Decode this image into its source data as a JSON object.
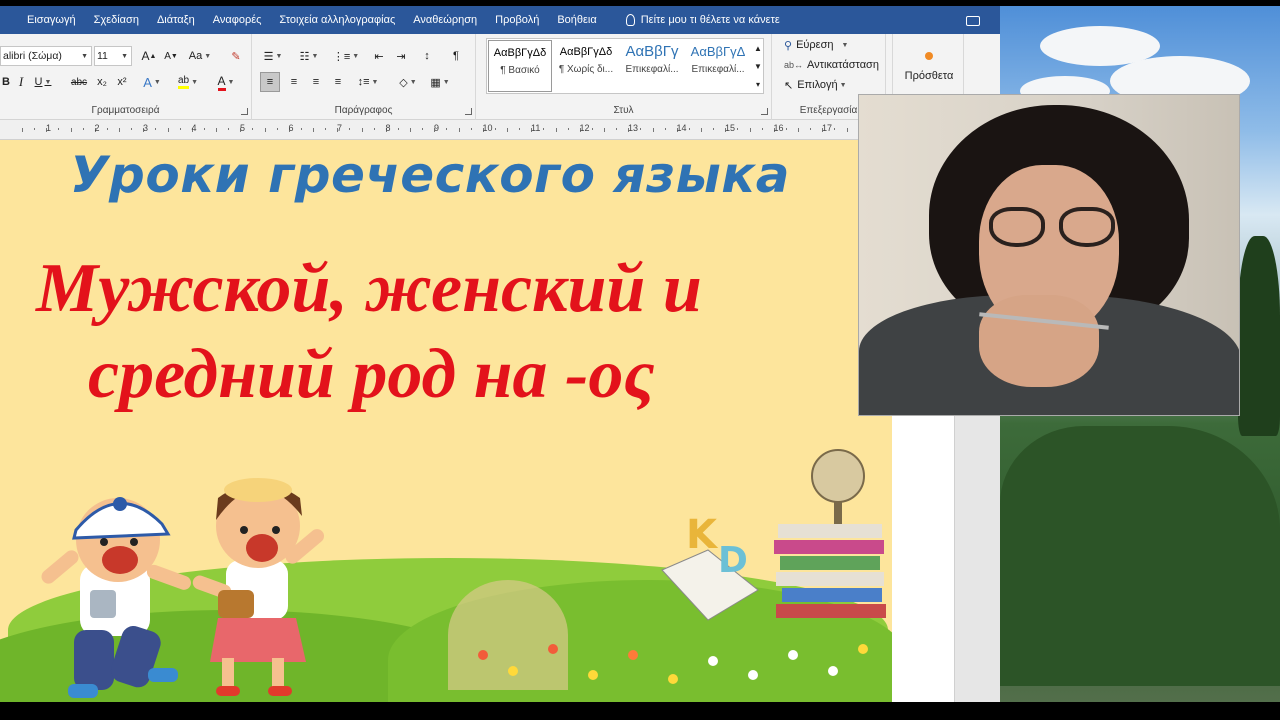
{
  "ribbon_tabs": [
    "Εισαγωγή",
    "Σχεδίαση",
    "Διάταξη",
    "Αναφορές",
    "Στοιχεία αλληλογραφίας",
    "Αναθεώρηση",
    "Προβολή",
    "Βοήθεια"
  ],
  "tell_me": "Πείτε μου τι θέλετε να κάνετε",
  "font": {
    "name": "alibri (Σώμα)",
    "size": "11",
    "grow": "A",
    "shrink": "A",
    "case": "Aa",
    "bold": "B",
    "italic": "I",
    "underline": "U",
    "strike": "abc",
    "subscript": "x₂",
    "superscript": "x²",
    "effects": "A",
    "highlight": "ab",
    "color": "A",
    "group_label": "Γραμματοσειρά"
  },
  "paragraph": {
    "pilcrow": "¶",
    "group_label": "Παράγραφος"
  },
  "styles": {
    "items": [
      {
        "preview": "AαBβΓγΔδ",
        "name": "¶ Βασικό"
      },
      {
        "preview": "AαBβΓγΔδ",
        "name": "¶ Χωρίς δι..."
      },
      {
        "preview": "AαBβΓγ",
        "name": "Επικεφαλί..."
      },
      {
        "preview": "AαBβΓγΔ",
        "name": "Επικεφαλί..."
      }
    ],
    "group_label": "Στυλ"
  },
  "editing": {
    "find": "Εύρεση",
    "replace": "Αντικατάσταση",
    "select": "Επιλογή",
    "group_label": "Επεξεργασία"
  },
  "addins": {
    "label": "Πρόσθετα"
  },
  "ruler_numbers": [
    "1",
    "2",
    "3",
    "4",
    "5",
    "6",
    "7",
    "8",
    "9",
    "10",
    "11",
    "12",
    "13",
    "14",
    "15",
    "16",
    "17"
  ],
  "document": {
    "title": "Уроки греческого языка",
    "subtitle_line1": "Мужской, женский и",
    "subtitle_line2": "средний род  на -ος"
  },
  "colors": {
    "word_blue": "#2b579a",
    "page_bg": "#fde59c",
    "title_blue": "#2f73b4",
    "title_red": "#e3121b"
  }
}
